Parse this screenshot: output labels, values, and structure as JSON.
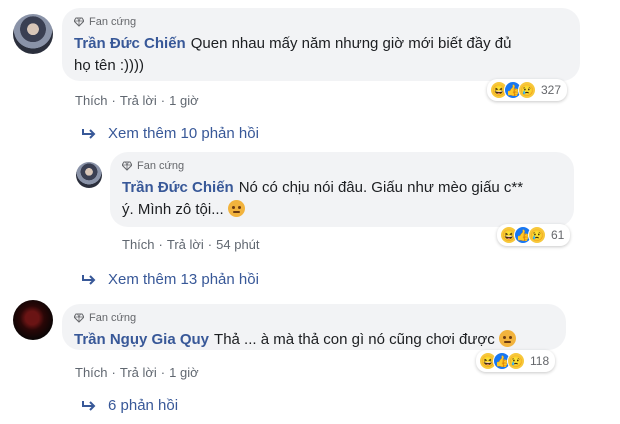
{
  "comments": [
    {
      "badge": "Fan cứng",
      "author": "Trần Đức Chiến",
      "text_line1": "Quen nhau mấy năm nhưng giờ mới biết đầy đủ",
      "text_line2": "họ tên :))))",
      "like": "Thích",
      "reply": "Trả lời",
      "time": "1 giờ",
      "reaction_count": "327",
      "reactions": [
        "haha-icon",
        "like-icon",
        "sad-icon"
      ]
    },
    {
      "badge": "Fan cứng",
      "author": "Trần Đức Chiến",
      "text_line1": "Nó có chịu nói đâu. Giấu như mèo giấu c**",
      "text_line2": "ý. Mình zô tội...",
      "like": "Thích",
      "reply": "Trả lời",
      "time": "54 phút",
      "reaction_count": "61",
      "reactions": [
        "haha-icon",
        "like-icon",
        "sad-icon"
      ]
    },
    {
      "badge": "Fan cứng",
      "author": "Trần Ngụy Gia Quy",
      "text_line1": "Thả ... à mà thả con gì nó cũng chơi được",
      "like": "Thích",
      "reply": "Trả lời",
      "time": "1 giờ",
      "reaction_count": "118",
      "reactions": [
        "haha-icon",
        "like-icon",
        "sad-icon"
      ]
    }
  ],
  "more_replies": [
    "Xem thêm 10 phản hồi",
    "Xem thêm 13 phản hồi",
    "6 phản hồi"
  ],
  "colors": {
    "author": "#385898",
    "bubble": "#f2f3f5",
    "meta": "#606770"
  }
}
